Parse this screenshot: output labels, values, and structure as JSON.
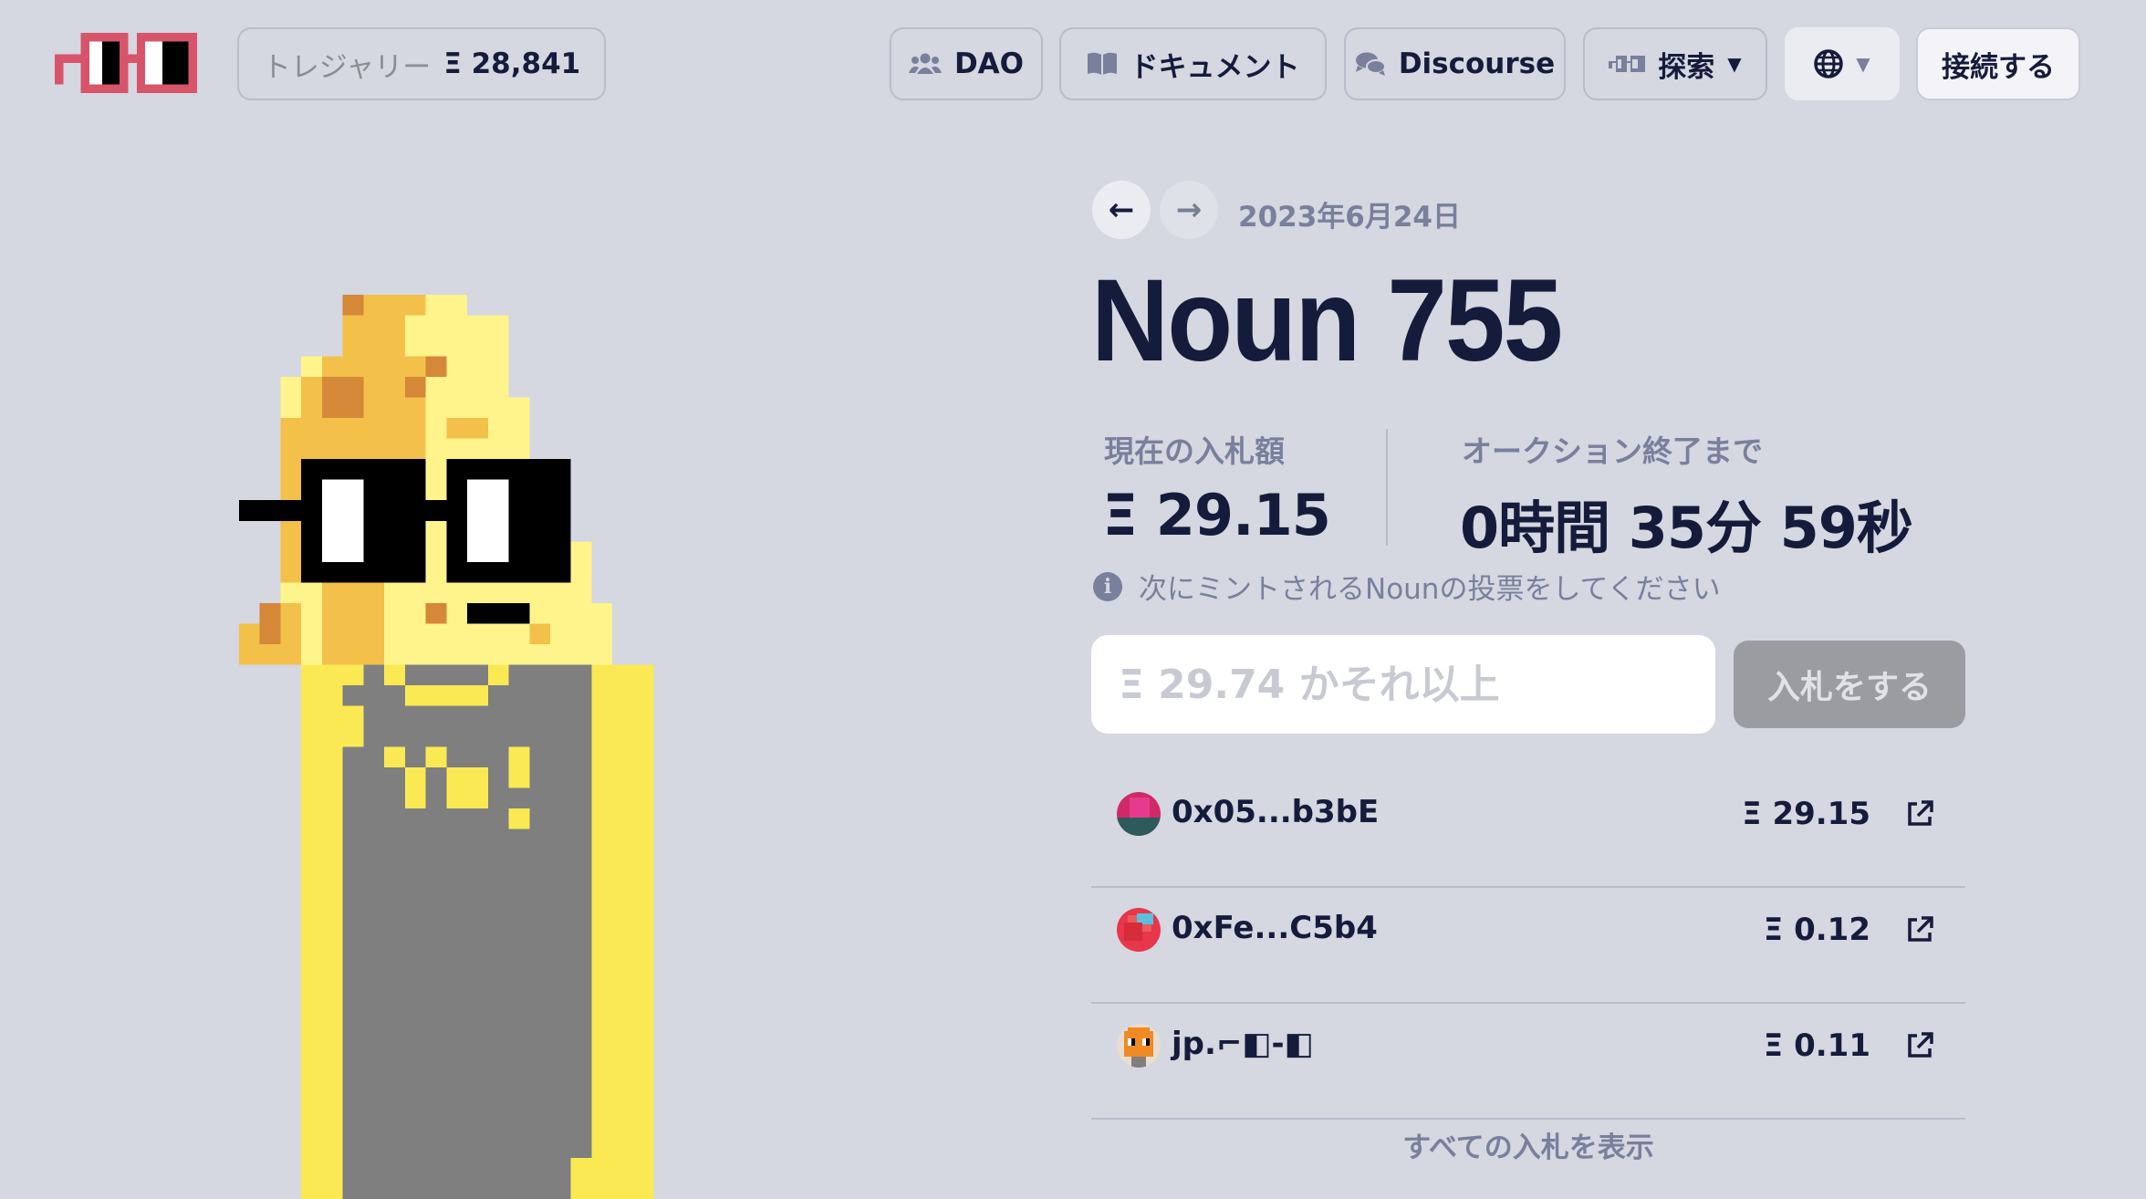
{
  "nav": {
    "treasury_label": "トレジャリー",
    "treasury_value": "Ξ 28,841",
    "dao_label": "DAO",
    "docs_label": "ドキュメント",
    "discourse_label": "Discourse",
    "explore_label": "探索",
    "connect_label": "接続する",
    "icons": [
      "users-icon",
      "book-icon",
      "comments-icon",
      "glasses-icon",
      "globe-icon",
      "caret-down-icon"
    ]
  },
  "auction": {
    "prev_arrow": "←",
    "next_arrow": "→",
    "date": "2023年6月24日",
    "title": "Noun 755",
    "current_bid_label": "現在の入札額",
    "current_bid_value": "Ξ 29.15",
    "ends_in_label": "オークション終了まで",
    "ends_in_value": "0時間 35分 59秒",
    "vote_note": "次にミントされるNounの投票をしてください",
    "bid_placeholder": "Ξ 29.74 かそれ以上",
    "bid_button": "入札をする",
    "view_all_bids": "すべての入札を表示"
  },
  "bids": [
    {
      "bidder": "0x05...b3bE",
      "amount": "Ξ 29.15"
    },
    {
      "bidder": "0xFe...C5b4",
      "amount": "Ξ 0.12"
    },
    {
      "bidder": "jp.⌐◧-◧",
      "amount": "Ξ 0.11"
    }
  ],
  "colors": {
    "background": "#d5d7e1",
    "text": "#151c3b",
    "muted": "#79809c",
    "logo_red": "#d7546b"
  }
}
